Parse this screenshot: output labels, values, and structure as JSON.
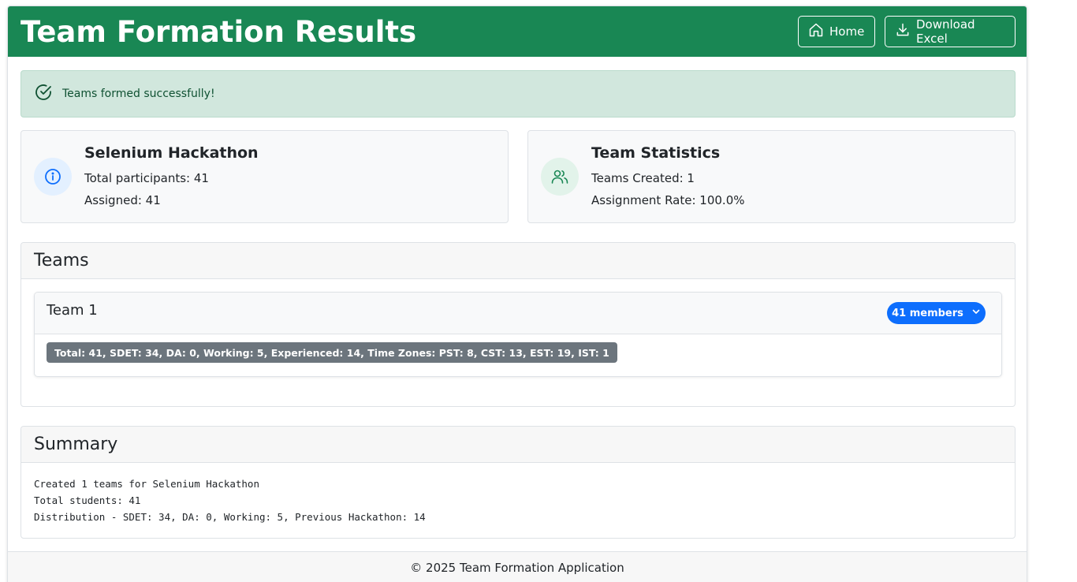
{
  "header": {
    "title": "Team Formation Results",
    "home_label": "Home",
    "download_label": "Download Excel"
  },
  "alert": {
    "message": "Teams formed successfully!"
  },
  "hackathon_card": {
    "title": "Selenium Hackathon",
    "line1": "Total participants: 41",
    "line2": "Assigned: 41",
    "icon": "info-icon"
  },
  "stats_card": {
    "title": "Team Statistics",
    "line1": "Teams Created: 1",
    "line2": "Assignment Rate: 100.0%",
    "icon": "users-icon"
  },
  "teams": {
    "heading": "Teams",
    "items": [
      {
        "name": "Team 1",
        "members_label": "41 members",
        "stats": "Total: 41, SDET: 34, DA: 0, Working: 5, Experienced: 14, Time Zones: PST: 8, CST: 13, EST: 19, IST: 1"
      }
    ]
  },
  "summary": {
    "heading": "Summary",
    "lines": [
      "Created 1 teams for Selenium Hackathon",
      "Total students: 41",
      "Distribution - SDET: 34, DA: 0, Working: 5, Previous Hackathon: 14"
    ]
  },
  "footer": {
    "text": "© 2025 Team Formation Application"
  },
  "colors": {
    "header_bg": "#198754",
    "alert_bg": "#d1e7dd",
    "pill_bg": "#0d6efd",
    "badge_bg": "#6c757d"
  }
}
